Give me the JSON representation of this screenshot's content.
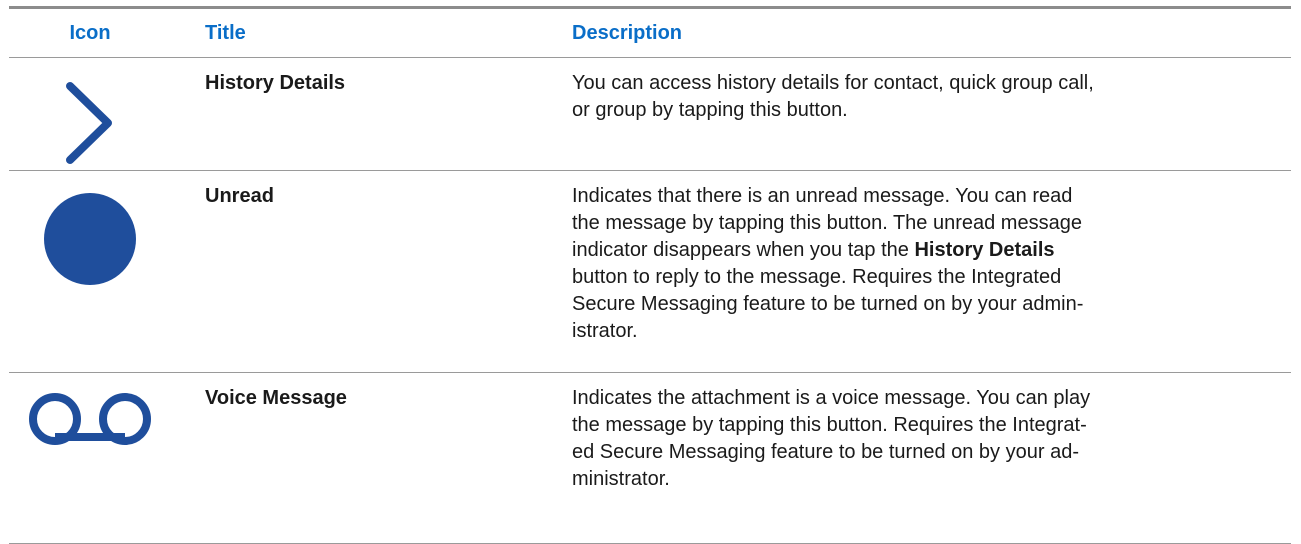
{
  "table": {
    "headers": {
      "icon": "Icon",
      "title": "Title",
      "description": "Description"
    },
    "rows": [
      {
        "icon": "chevron-right-icon",
        "title": "History Details",
        "description_lines": [
          "You can access history details for contact, quick group call,",
          "or group by tapping this button."
        ]
      },
      {
        "icon": "filled-circle-icon",
        "title": "Unread",
        "description_lines": [
          "Indicates that there is an unread message. You can read",
          "the message by tapping this button. The unread message",
          "indicator disappears when you tap the",
          "History Details",
          "button to reply to the message. Requires the Integrated",
          "Secure Messaging feature to be turned on by your admin-",
          "istrator."
        ]
      },
      {
        "icon": "voicemail-icon",
        "title": "Voice Message",
        "description_lines": [
          "Indicates the attachment is a voice message. You can play",
          "the message by tapping this button. Requires the Integrat-",
          "ed Secure Messaging feature to be turned on by your ad-",
          "ministrator."
        ]
      }
    ]
  },
  "colors": {
    "header_text": "#0a6ec8",
    "icon_blue": "#1f4e9c",
    "rule": "#8c8c8c"
  }
}
